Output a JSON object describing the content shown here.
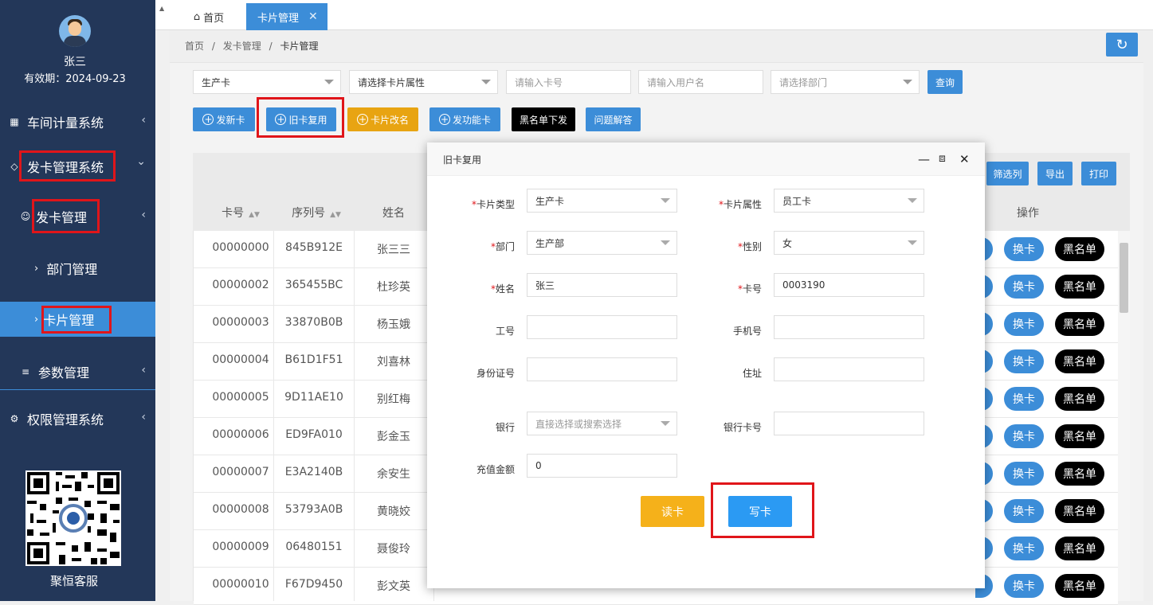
{
  "sidebar": {
    "user_name": "张三",
    "expiry": "有效期：2024-09-23",
    "menu": {
      "workshop": "车间计量系统",
      "card_system": "发卡管理系统",
      "card_mgmt": "发卡管理",
      "dept_mgmt": "部门管理",
      "card_list": "卡片管理",
      "params": "参数管理",
      "permission": "权限管理系统"
    },
    "qr_label": "聚恒客服"
  },
  "tabs": {
    "home": "首页",
    "active": "卡片管理"
  },
  "breadcrumb": {
    "home": "首页",
    "sep": "/",
    "section": "发卡管理",
    "current": "卡片管理"
  },
  "filters": {
    "card_type": "生产卡",
    "card_attr_placeholder": "请选择卡片属性",
    "card_no_placeholder": "请输入卡号",
    "user_placeholder": "请输入用户名",
    "dept_placeholder": "请选择部门",
    "query": "查询"
  },
  "actions": {
    "new_card": "发新卡",
    "reuse_card": "旧卡复用",
    "rename_card": "卡片改名",
    "function_card": "发功能卡",
    "blacklist_issue": "黑名单下发",
    "faq": "问题解答"
  },
  "table_tools": {
    "filter_cols": "筛选列",
    "export": "导出",
    "print": "打印"
  },
  "table": {
    "headers": {
      "card_no": "卡号",
      "serial": "序列号",
      "name": "姓名",
      "ops": "操作"
    },
    "swap_label": "换卡",
    "blacklist_label": "黑名单",
    "rows": [
      {
        "card_no": "00000000",
        "serial": "845B912E",
        "name": "张三三"
      },
      {
        "card_no": "00000002",
        "serial": "365455BC",
        "name": "杜珍英"
      },
      {
        "card_no": "00000003",
        "serial": "33870B0B",
        "name": "杨玉娥"
      },
      {
        "card_no": "00000004",
        "serial": "B61D1F51",
        "name": "刘喜林"
      },
      {
        "card_no": "00000005",
        "serial": "9D11AE10",
        "name": "别红梅"
      },
      {
        "card_no": "00000006",
        "serial": "ED9FA010",
        "name": "彭金玉"
      },
      {
        "card_no": "00000007",
        "serial": "E3A2140B",
        "name": "余安生"
      },
      {
        "card_no": "00000008",
        "serial": "53793A0B",
        "name": "黄晓姣"
      },
      {
        "card_no": "00000009",
        "serial": "06480151",
        "name": "聂俊玲"
      },
      {
        "card_no": "00000010",
        "serial": "F67D9450",
        "name": "彭文英"
      }
    ]
  },
  "modal": {
    "title": "旧卡复用",
    "labels": {
      "card_type": "卡片类型",
      "card_attr": "卡片属性",
      "dept": "部门",
      "gender": "性别",
      "name": "姓名",
      "card_no": "卡号",
      "emp_no": "工号",
      "phone": "手机号",
      "id_no": "身份证号",
      "address": "住址",
      "bank": "银行",
      "bank_card": "银行卡号",
      "recharge": "充值金额"
    },
    "values": {
      "card_type": "生产卡",
      "card_attr": "员工卡",
      "dept": "生产部",
      "gender": "女",
      "name": "张三",
      "card_no": "0003190",
      "bank_placeholder": "直接选择或搜索选择",
      "recharge": "0"
    },
    "read_btn": "读卡",
    "write_btn": "写卡"
  },
  "colors": {
    "sidebar_bg": "#233759",
    "accent_blue": "#3c8dd8",
    "warning_yellow": "#f5b11a",
    "highlight_red": "#e0151a"
  }
}
